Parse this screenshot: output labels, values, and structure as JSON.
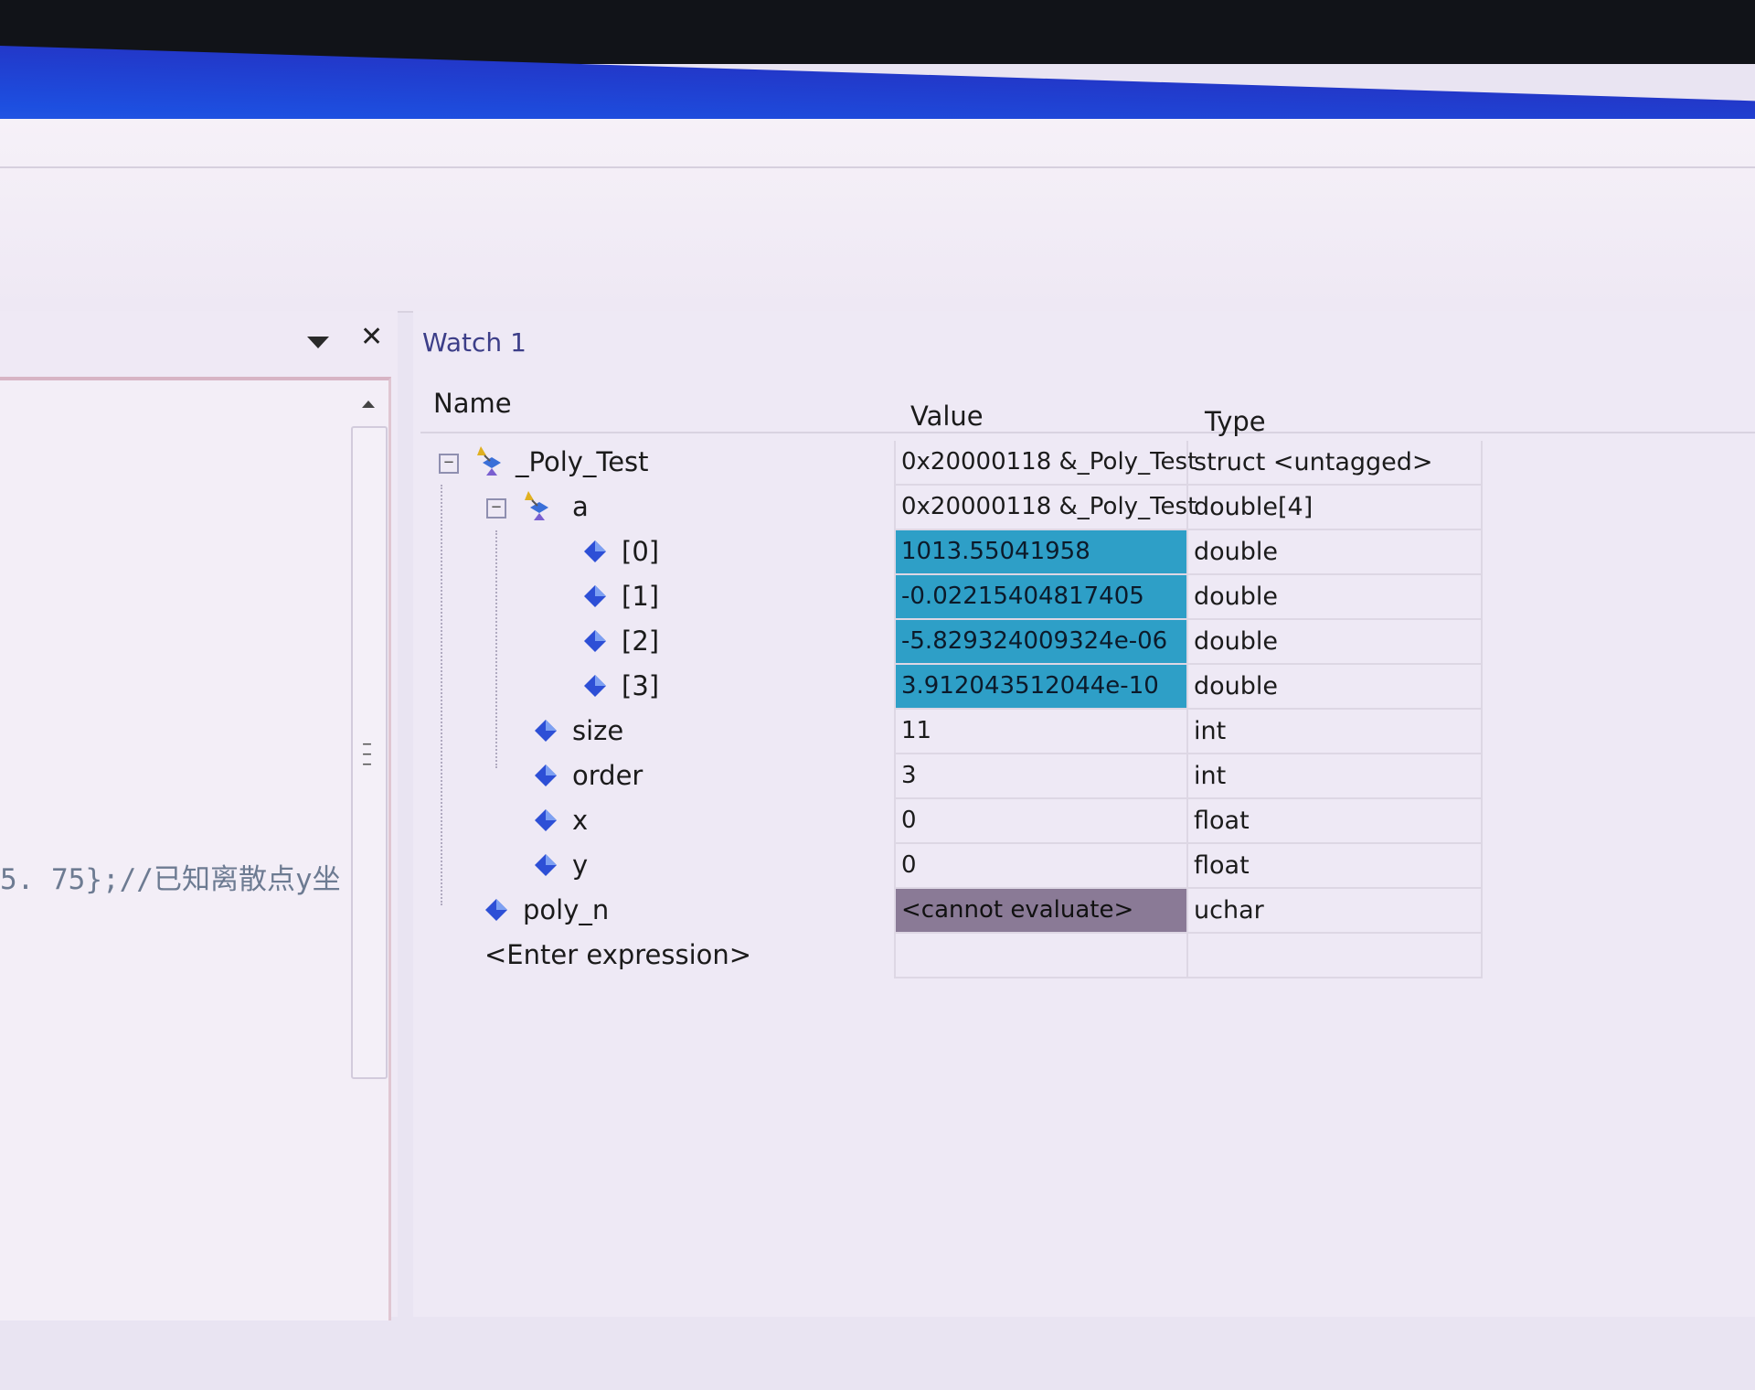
{
  "left_pane": {
    "code_snippet": "5. 75};//已知离散点y坐"
  },
  "watch": {
    "title": "Watch 1",
    "columns": {
      "name": "Name",
      "value": "Value",
      "type": "Type"
    },
    "rows": [
      {
        "name": "_Poly_Test",
        "value": "0x20000118 &_Poly_Test",
        "type": "struct <untagged>"
      },
      {
        "name": "a",
        "value": "0x20000118 &_Poly_Test",
        "type": "double[4]"
      },
      {
        "name": "[0]",
        "value": "1013.55041958",
        "type": "double"
      },
      {
        "name": "[1]",
        "value": "-0.02215404817405",
        "type": "double"
      },
      {
        "name": "[2]",
        "value": "-5.829324009324e-06",
        "type": "double"
      },
      {
        "name": "[3]",
        "value": "3.912043512044e-10",
        "type": "double"
      },
      {
        "name": "size",
        "value": "11",
        "type": "int"
      },
      {
        "name": "order",
        "value": "3",
        "type": "int"
      },
      {
        "name": "x",
        "value": "0",
        "type": "float"
      },
      {
        "name": "y",
        "value": "0",
        "type": "float"
      },
      {
        "name": "poly_n",
        "value": "<cannot evaluate>",
        "type": "uchar"
      }
    ],
    "enter_expression": "<Enter expression>"
  },
  "colors": {
    "title_bar": "#1d4fe0",
    "changed_value_highlight": "#2e9fc7",
    "error_value_highlight": "#8a7a96"
  }
}
